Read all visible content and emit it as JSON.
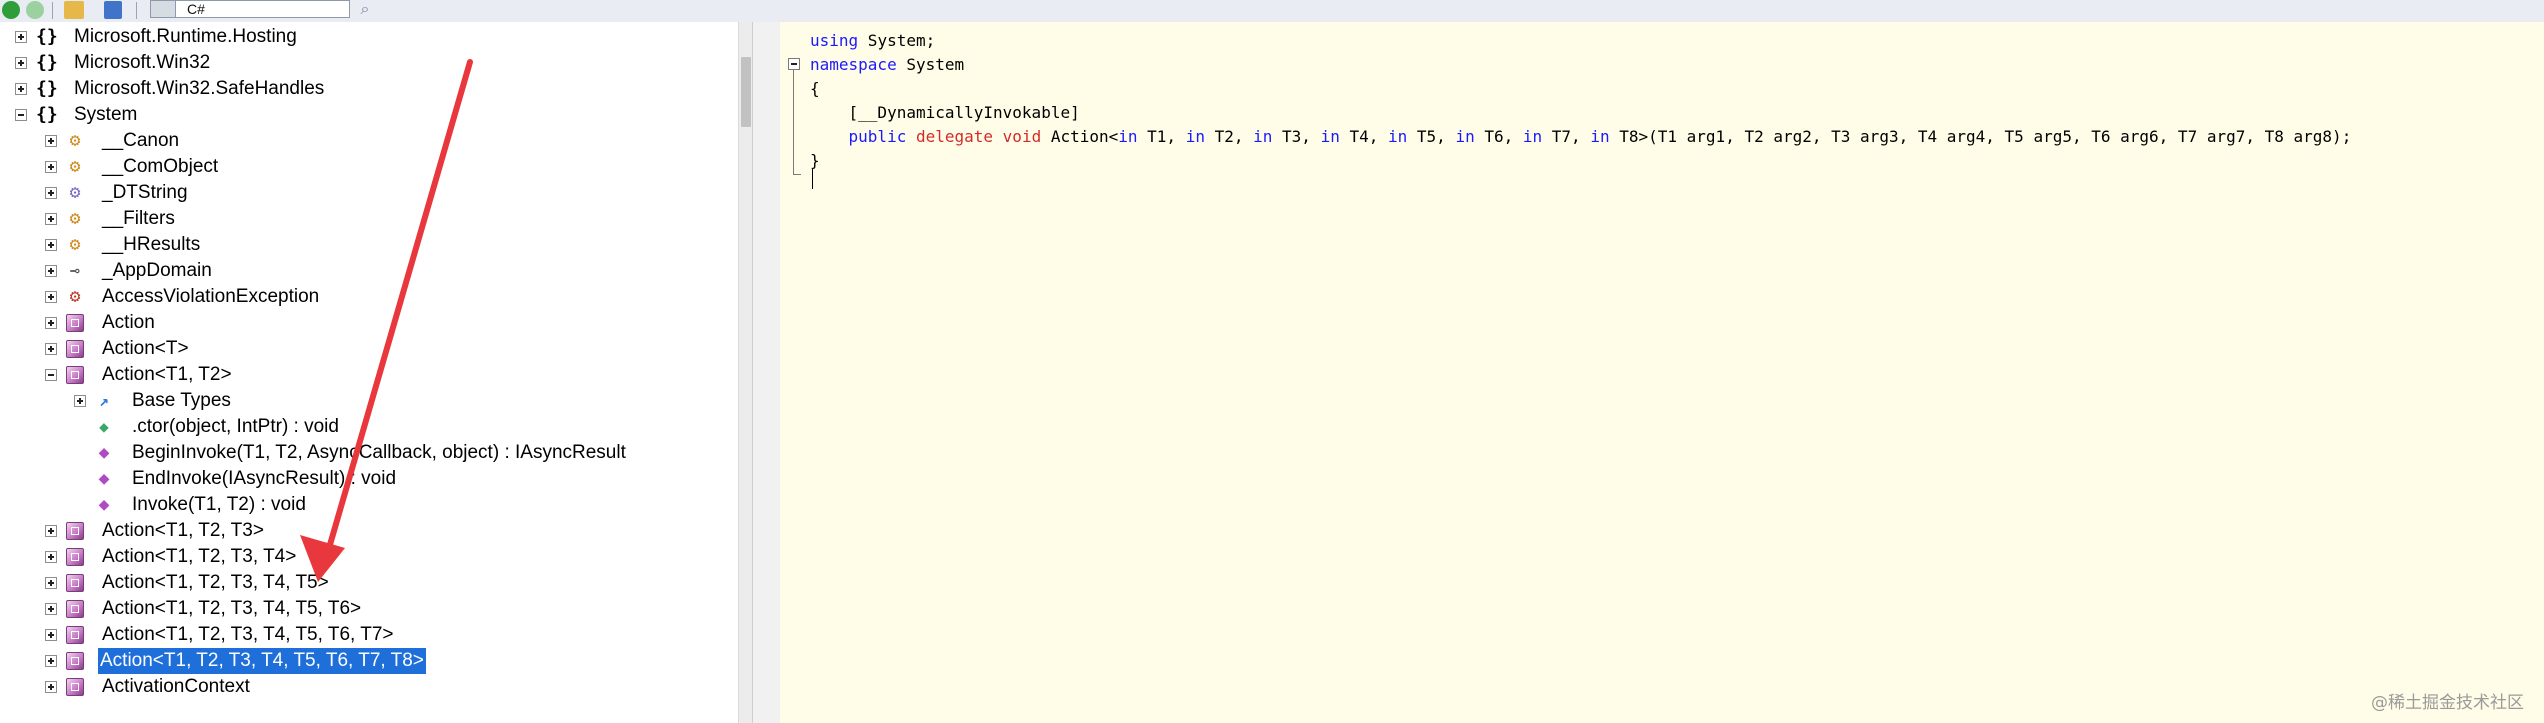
{
  "toolbar": {
    "language": "C#",
    "back_icon": "back-arrow-icon",
    "forward_icon": "forward-arrow-icon",
    "open_icon": "folder-open-icon",
    "refresh_icon": "refresh-icon",
    "language_icon": "language-icon",
    "search_icon": "search-icon"
  },
  "tree": {
    "rows": [
      {
        "label": "Microsoft.Runtime.Hosting",
        "icon": "namespace-icon"
      },
      {
        "label": "Microsoft.Win32",
        "icon": "namespace-icon"
      },
      {
        "label": "Microsoft.Win32.SafeHandles",
        "icon": "namespace-icon"
      },
      {
        "label": "System",
        "icon": "namespace-icon"
      },
      {
        "label": "__Canon",
        "icon": "class-gears-icon"
      },
      {
        "label": "__ComObject",
        "icon": "class-gears-icon"
      },
      {
        "label": "_DTString",
        "icon": "struct-gears-icon"
      },
      {
        "label": "__Filters",
        "icon": "class-gears-icon"
      },
      {
        "label": "__HResults",
        "icon": "class-gears-icon"
      },
      {
        "label": "_AppDomain",
        "icon": "interface-key-icon"
      },
      {
        "label": "AccessViolationException",
        "icon": "exception-gears-icon"
      },
      {
        "label": "Action",
        "icon": "delegate-icon"
      },
      {
        "label": "Action<T>",
        "icon": "delegate-icon"
      },
      {
        "label": "Action<T1, T2>",
        "icon": "delegate-icon"
      },
      {
        "label": "Base Types",
        "icon": "base-types-icon"
      },
      {
        "label": ".ctor(object, IntPtr) : void",
        "icon": "constructor-icon"
      },
      {
        "label": "BeginInvoke(T1, T2, AsyncCallback, object) : IAsyncResult",
        "icon": "method-icon"
      },
      {
        "label": "EndInvoke(IAsyncResult) : void",
        "icon": "method-icon"
      },
      {
        "label": "Invoke(T1, T2) : void",
        "icon": "method-icon"
      },
      {
        "label": "Action<T1, T2, T3>",
        "icon": "delegate-icon"
      },
      {
        "label": "Action<T1, T2, T3, T4>",
        "icon": "delegate-icon"
      },
      {
        "label": "Action<T1, T2, T3, T4, T5>",
        "icon": "delegate-icon"
      },
      {
        "label": "Action<T1, T2, T3, T4, T5, T6>",
        "icon": "delegate-icon"
      },
      {
        "label": "Action<T1, T2, T3, T4, T5, T6, T7>",
        "icon": "delegate-icon"
      },
      {
        "label": "Action<T1, T2, T3, T4, T5, T6, T7, T8>",
        "icon": "delegate-icon"
      },
      {
        "label": "ActivationContext",
        "icon": "delegate-icon"
      }
    ],
    "selected_label": "Action<T1, T2, T3, T4, T5, T6, T7, T8>"
  },
  "code": {
    "line1_kw": "using",
    "line1_rest": " System;",
    "line2_kw": "namespace",
    "line2_rest": " System",
    "line3": "{",
    "line4": "    [__DynamicallyInvokable]",
    "line5_indent": "    ",
    "line5_public": "public",
    "line5_delegate": "delegate",
    "line5_void": "void",
    "line5_name": " Action<",
    "line5_in": "in",
    "line5_t1": " T1, ",
    "line5_t2": " T2, ",
    "line5_t3": " T3, ",
    "line5_t4": " T4, ",
    "line5_t5": " T5, ",
    "line5_t6": " T6, ",
    "line5_t7": " T7, ",
    "line5_t8": " T8>",
    "line5_params": "(T1 arg1, T2 arg2, T3 arg3, T4 arg4, T5 arg5, T6 arg6, T7 arg7, T8 arg8);",
    "line6": "}"
  },
  "watermark": "@稀土掘金技术社区",
  "annotation": {
    "arrow_color": "#e8383d"
  }
}
